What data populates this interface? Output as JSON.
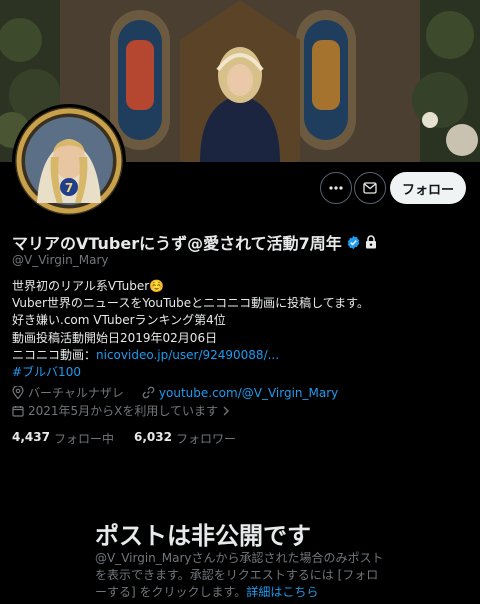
{
  "profile": {
    "display_name": "マリアのVTuberにうず@愛されて活動7周年",
    "handle": "@V_Virgin_Mary",
    "bio_lines": [
      "世界初のリアル系VTuber☺️",
      "Vuber世界のニュースをYouTubeとニコニコ動画に投稿してます。",
      "好き嫌い.com VTuberランキング第4位",
      "動画投稿活動開始日2019年02月06日"
    ],
    "bio_nico_prefix": "ニコニコ動画：",
    "bio_nico_link": "nicovideo.jp/user/92490088/...",
    "hashtag": "#ブルバ100",
    "location": "バーチャルナザレ",
    "website": "youtube.com/@V_Virgin_Mary",
    "joined": "2021年5月からXを利用しています",
    "following_count": "4,437",
    "following_label": "フォロー中",
    "followers_count": "6,032",
    "followers_label": "フォロワー"
  },
  "actions": {
    "follow_label": "フォロー"
  },
  "private_notice": {
    "title": "ポストは非公開です",
    "line1": "@V_Virgin_Maryさんから承認された場合のみポスト",
    "line2": "を表示できます。承認をリクエストするには [フォロ",
    "line3_prefix": "ーする] をクリックします。",
    "line3_link": "詳細はこちら"
  },
  "colors": {
    "background": "#000000",
    "primary_text": "#e7e9ea",
    "secondary_text": "#71767b",
    "link": "#1d9bf0",
    "verified": "#1d9bf0"
  }
}
